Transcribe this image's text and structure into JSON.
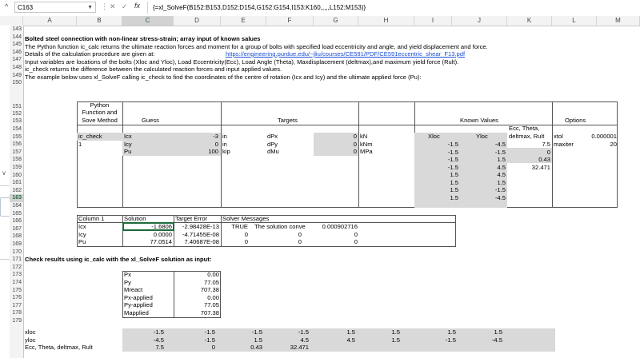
{
  "formula_bar": {
    "name_box": "C163",
    "formula": "{=xl_SolveF(B152:B153,D152:D154,G152:G154,I153:K160,,,,,L152:M153)}",
    "fx_label": "fx"
  },
  "columns": [
    "A",
    "B",
    "C",
    "D",
    "E",
    "F",
    "G",
    "H",
    "I",
    "J",
    "K",
    "L",
    "M"
  ],
  "rows": [
    "143",
    "144",
    "145",
    "146",
    "147",
    "148",
    "149",
    "150",
    "151",
    "152",
    "153",
    "154",
    "155",
    "156",
    "157",
    "158",
    "159",
    "160",
    "161",
    "162",
    "163",
    "164",
    "165",
    "166",
    "167",
    "168",
    "169",
    "170",
    "171",
    "172",
    "173",
    "174",
    "175",
    "176",
    "177",
    "178",
    "179"
  ],
  "selected_row": "163",
  "text": {
    "r144": "Bolted steel  connection with  non-linear stress-strain; array input of known salues",
    "r145": "The Python function ic_calc returns the ultimate reaction forces and moment for a group of bolts with specified load eccentricity and angle, and yield displacement and force.",
    "r146": "Details of the calculation procedure are given at:",
    "r146_link": "https://engineering.purdue.edu/~jliu/courses/CE591/PDF/CE591eccentric_shear_F13.pdf",
    "r147": "Input variables are locations of the bolts (Xloc and Yloc), Load Eccentricity(Ecc), Load Angle (Theta), Maxdisplacement (deltmax),and maximum yield force (Rult).",
    "r148": "ic_check returns the difference between the calculated reaction forces and input applied values.",
    "r149": "The example below uses xl_SolveF calling ic_check to find the coordinates of the centre of rotation (Icx and Icy) and the ultimate applied force (Pu):",
    "r167": "Check results using ic_calc with the xl_SolveF solution as input:"
  },
  "table1": {
    "hdr_method": [
      "Python",
      "Function and",
      "Sove Method"
    ],
    "hdr_guess": "Guess",
    "hdr_targets": "Targets",
    "hdr_known": "Known Values",
    "hdr_options": "Options",
    "b152": "ic_check",
    "b153": "1",
    "guess_labels": [
      "Icx",
      "Icy",
      "Pu"
    ],
    "guess_values": [
      "-3",
      "0",
      "100"
    ],
    "guess_units": [
      "in",
      "in",
      "kip"
    ],
    "target_labels": [
      "dPx",
      "dPy",
      "dMu"
    ],
    "target_values": [
      "0",
      "0",
      "0"
    ],
    "target_units": [
      "kN",
      "kNm",
      "MPa"
    ],
    "xloc_hdr": "Xloc",
    "yloc_hdr": "Yloc",
    "ecc_hdr": [
      "Ecc, Theta,",
      "deltmax, Rult"
    ],
    "xloc": [
      "-1.5",
      "-1.5",
      "-1.5",
      "-1.5",
      "1.5",
      "1.5",
      "1.5",
      "1.5"
    ],
    "yloc": [
      "-4.5",
      "-1.5",
      "1.5",
      "4.5",
      "4.5",
      "1.5",
      "-1.5",
      "-4.5"
    ],
    "ecc": [
      "7.5",
      "0",
      "0.43",
      "32.471"
    ],
    "opt_labels": [
      "xtol",
      "maxiter"
    ],
    "opt_values": [
      "0.000001",
      "20"
    ]
  },
  "table2": {
    "headers": [
      "Column 1",
      "Solution",
      "Target Error",
      "Solver Messages"
    ],
    "labels": [
      "Icx",
      "Icy",
      "Pu"
    ],
    "solution": [
      "-1.6806",
      "0.0000",
      "77.0514"
    ],
    "error": [
      "-2.98428E-13",
      "-4.71455E-08",
      "7.40687E-08"
    ],
    "msg_row1": [
      "TRUE",
      "The solution conve",
      "0.000902716"
    ],
    "msg_row2": [
      "0",
      "0",
      "0"
    ],
    "msg_row3": [
      "0",
      "0",
      "0"
    ]
  },
  "table3": {
    "labels": [
      "Px",
      "Py",
      "Mreact",
      "Px-applied",
      "Py-applied",
      "Mapplied"
    ],
    "values": [
      "0.00",
      "77.05",
      "707.38",
      "0.00",
      "77.05",
      "707.38"
    ]
  },
  "table4": {
    "labels": [
      "xloc",
      "yloc",
      "Ecc, Theta, deltmax, Rult"
    ],
    "xloc": [
      "-1.5",
      "-1.5",
      "-1.5",
      "-1.5",
      "1.5",
      "1.5",
      "1.5",
      "1.5"
    ],
    "yloc": [
      "-4.5",
      "-1.5",
      "1.5",
      "4.5",
      "4.5",
      "1.5",
      "-1.5",
      "-4.5"
    ],
    "ecc": [
      "7.5",
      "0",
      "0.43",
      "32.471"
    ]
  },
  "colors": {
    "selection": "#1d6b3b",
    "input_fill": "#d9d9d9",
    "link": "#1a4fd6"
  }
}
